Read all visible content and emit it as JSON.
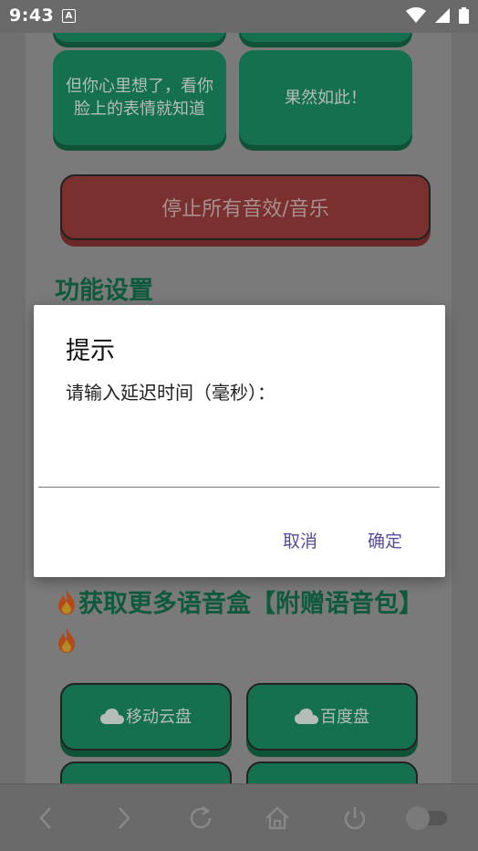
{
  "status_bar": {
    "time": "9:43",
    "notification_icon": "A"
  },
  "buttons_top": [
    {
      "label": "但你心里想了，看你脸上的表情就知道"
    },
    {
      "label": "果然如此！"
    }
  ],
  "stop_button": {
    "label": "停止所有音效/音乐"
  },
  "settings_section": {
    "title": "功能设置"
  },
  "promo_section": {
    "title": "获取更多语音盒【附赠语音包】"
  },
  "cloud_buttons": [
    {
      "label": "移动云盘",
      "icon": "cloud-icon"
    },
    {
      "label": "百度盘",
      "icon": "cloud-icon"
    }
  ],
  "dialog": {
    "title": "提示",
    "message": "请输入延迟时间（毫秒）：",
    "input_value": "",
    "cancel_label": "取消",
    "confirm_label": "确定"
  },
  "nav_bar": {
    "items": [
      "back-icon",
      "forward-icon",
      "refresh-icon",
      "home-icon",
      "power-icon",
      "toggle-switch"
    ]
  },
  "colors": {
    "accent_green": "#157050",
    "stop_red": "#7b3030",
    "dialog_button": "#5a4a9a"
  }
}
